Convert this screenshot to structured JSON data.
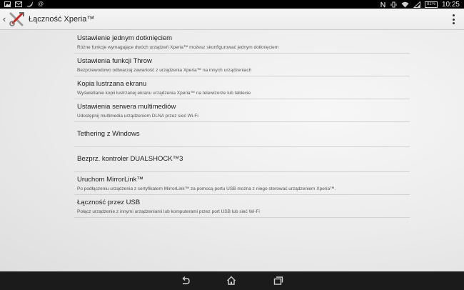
{
  "status_bar": {
    "left_icons": [
      "image-icon",
      "mail-icon",
      "twitter-icon",
      "at-icon"
    ],
    "right_icons": [
      "nfc-icon",
      "vibrate-icon",
      "wifi-icon",
      "signal-icon"
    ],
    "battery": "81%",
    "clock": "10:25"
  },
  "action_bar": {
    "title": "Łączność Xperia™"
  },
  "settings": {
    "items": [
      {
        "title": "Ustawienie jednym dotknięciem",
        "subtitle": "Różne funkcje wymagające dwóch urządzeń Xperia™ możesz skonfigurować jednym dotknięciem"
      },
      {
        "title": "Ustawienia funkcji Throw",
        "subtitle": "Bezprzewodowo odtwarzaj zawartość z urządzenia Xperia™ na innych urządzeniach"
      },
      {
        "title": "Kopia lustrzana ekranu",
        "subtitle": "Wyświetlanie kopii lustrzanej ekranu urządzenia Xperia™ na telewizorze lub tablecie"
      },
      {
        "title": "Ustawienia serwera multimediów",
        "subtitle": "Udostępnij multimedia urządzeniom DLNA przez sieć Wi-Fi"
      },
      {
        "title": "Tethering z Windows",
        "subtitle": ""
      },
      {
        "title": "Bezprz. kontroler DUALSHOCK™3",
        "subtitle": ""
      },
      {
        "title": "Uruchom MirrorLink™",
        "subtitle": "Po podłączeniu urządzenia z certyfikatem MirrorLink™ za pomocą portu USB można z niego sterować urządzeniem Xperia™."
      },
      {
        "title": "Łączność przez USB",
        "subtitle": "Połącz urządzenie z innymi urządzeniami lub komputerami przez port USB lub sieć Wi-Fi"
      }
    ]
  },
  "nav_bar": {
    "buttons": [
      "back-icon",
      "home-icon",
      "recent-apps-icon"
    ]
  }
}
